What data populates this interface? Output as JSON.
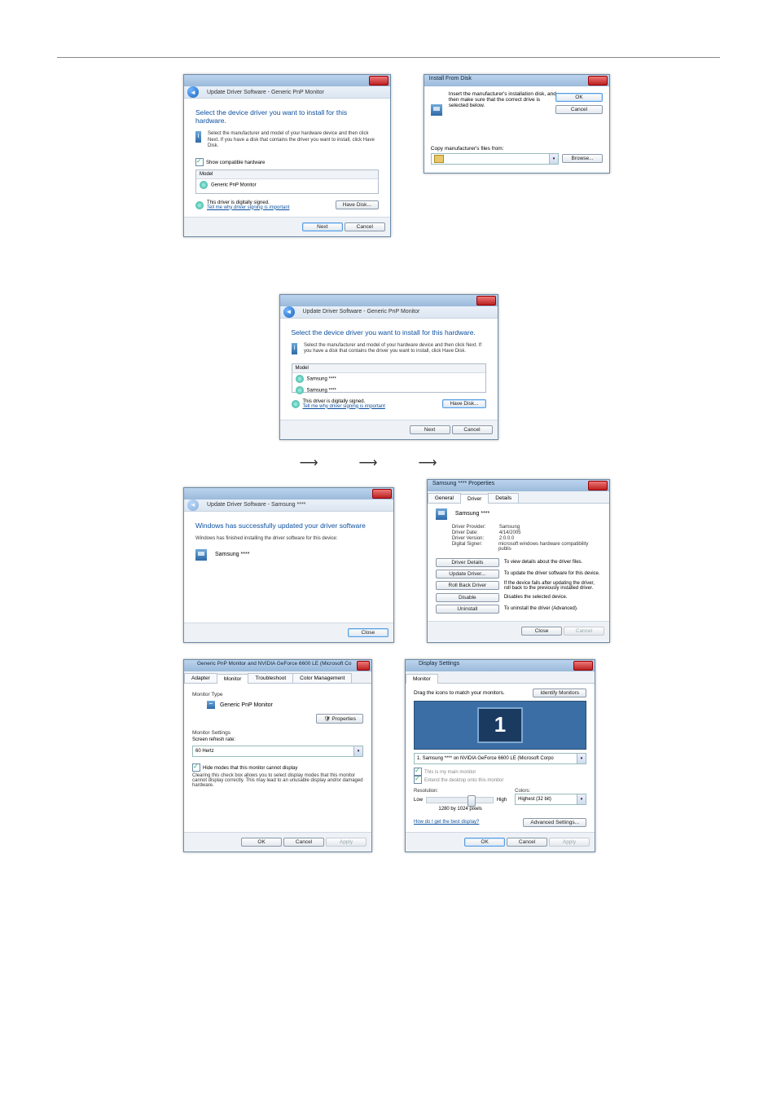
{
  "wizard": {
    "nav_title": "Update Driver Software - Generic PnP Monitor",
    "nav_title_samsung": "Update Driver Software - Samsung ****",
    "heading_select": "Select the device driver you want to install for this hardware.",
    "heading_success": "Windows has successfully updated your driver software",
    "instruction": "Select the manufacturer and model of your hardware device and then click Next. If you have a disk that contains the driver you want to install, click Have Disk.",
    "success_sub": "Windows has finished installing the driver software for this device:",
    "show_compat": "Show compatible hardware",
    "model_header": "Model",
    "model_generic": "Generic PnP Monitor",
    "model_samsung1": "Samsung ****",
    "model_samsung2": "Samsung ****",
    "signed_msg": "This driver is digitally signed.",
    "signing_link": "Tell me why driver signing is important",
    "have_disk": "Have Disk...",
    "next": "Next",
    "cancel": "Cancel",
    "close": "Close",
    "device_samsung": "Samsung ****"
  },
  "ifd": {
    "title": "Install From Disk",
    "msg": "Insert the manufacturer's installation disk, and then make sure that the correct drive is selected below.",
    "from_label": "Copy manufacturer's files from:",
    "ok": "OK",
    "cancel": "Cancel",
    "browse": "Browse..."
  },
  "props": {
    "title": "Samsung **** Properties",
    "tabs": {
      "general": "General",
      "driver": "Driver",
      "details": "Details"
    },
    "device": "Samsung ****",
    "kv": {
      "provider_k": "Driver Provider:",
      "provider_v": "Samsung",
      "date_k": "Driver Date:",
      "date_v": "4/14/2005",
      "version_k": "Driver Version:",
      "version_v": "2.0.0.0",
      "signer_k": "Digital Signer:",
      "signer_v": "microsoft windows hardware compatibility publis"
    },
    "btns": {
      "details": "Driver Details",
      "details_d": "To view details about the driver files.",
      "update": "Update Driver...",
      "update_d": "To update the driver software for this device.",
      "rollback": "Roll Back Driver",
      "rollback_d": "If the device fails after updating the driver, roll back to the previously installed driver.",
      "disable": "Disable",
      "disable_d": "Disables the selected device.",
      "uninstall": "Uninstall",
      "uninstall_d": "To uninstall the driver (Advanced)."
    },
    "close": "Close",
    "cancel": "Cancel"
  },
  "monprops": {
    "title": "Generic PnP Monitor and NVIDIA GeForce 6600 LE (Microsoft Co...",
    "tabs": {
      "adapter": "Adapter",
      "monitor": "Monitor",
      "trouble": "Troubleshoot",
      "color": "Color Management"
    },
    "type_label": "Monitor Type",
    "type_value": "Generic PnP Monitor",
    "properties_btn": "Properties",
    "settings_label": "Monitor Settings",
    "refresh_label": "Screen refresh rate:",
    "refresh_value": "60 Hertz",
    "hide_modes": "Hide modes that this monitor cannot display",
    "hide_desc": "Clearing this check box allows you to select display modes that this monitor cannot display correctly. This may lead to an unusable display and/or damaged hardware.",
    "ok": "OK",
    "cancel": "Cancel",
    "apply": "Apply"
  },
  "ds": {
    "title": "Display Settings",
    "tab": "Monitor",
    "drag": "Drag the icons to match your monitors.",
    "identify": "Identify Monitors",
    "mon_num": "1",
    "mon_list": "1. Samsung **** on NVIDIA GeForce 6600 LE (Microsoft Corpo",
    "main_chk": "This is my main monitor",
    "extend_chk": "Extend the desktop onto this monitor",
    "res_label": "Resolution:",
    "low": "Low",
    "high": "High",
    "res_value": "1280 by 1024 pixels",
    "colors_label": "Colors:",
    "colors_value": "Highest (32 bit)",
    "best_link": "How do I get the best display?",
    "advanced": "Advanced Settings...",
    "ok": "OK",
    "cancel": "Cancel",
    "apply": "Apply"
  }
}
